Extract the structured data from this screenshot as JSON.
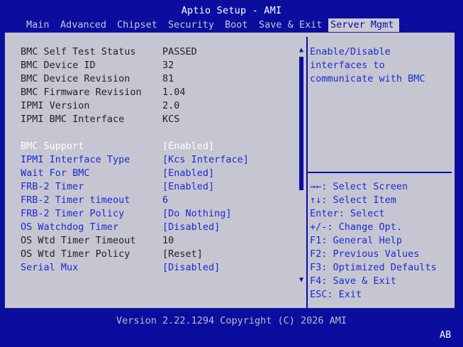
{
  "title": "Aptio Setup - AMI",
  "tabs": [
    "Main",
    "Advanced",
    "Chipset",
    "Security",
    "Boot",
    "Save & Exit",
    "Server Mgmt"
  ],
  "active_tab": "Server Mgmt",
  "info": [
    {
      "label": "BMC Self Test Status",
      "value": "PASSED"
    },
    {
      "label": "BMC Device ID",
      "value": "32"
    },
    {
      "label": "BMC Device Revision",
      "value": "81"
    },
    {
      "label": "BMC Firmware Revision",
      "value": "1.04"
    },
    {
      "label": "IPMI Version",
      "value": "2.0"
    },
    {
      "label": "IPMI BMC Interface",
      "value": "KCS"
    }
  ],
  "settings": [
    {
      "label": "BMC Support",
      "value": "[Enabled]"
    },
    {
      "label": "IPMI Interface Type",
      "value": "[Kcs Interface]"
    },
    {
      "label": "Wait For BMC",
      "value": "[Enabled]"
    },
    {
      "label": "FRB-2 Timer",
      "value": "[Enabled]"
    },
    {
      "label": "FRB-2 Timer timeout",
      "value": "6"
    },
    {
      "label": "FRB-2 Timer Policy",
      "value": "[Do Nothing]"
    },
    {
      "label": "OS Watchdog Timer",
      "value": "[Disabled]"
    },
    {
      "label": "OS Wtd Timer Timeout",
      "value": "10"
    },
    {
      "label": "OS Wtd Timer Policy",
      "value": "[Reset]"
    },
    {
      "label": "Serial Mux",
      "value": "[Disabled]"
    }
  ],
  "help_lines": [
    "Enable/Disable",
    "interfaces to",
    "communicate with BMC"
  ],
  "keys": [
    "→←: Select Screen",
    "↑↓: Select Item",
    "Enter: Select",
    "+/-: Change Opt.",
    "F1: General Help",
    "F2: Previous Values",
    "F3: Optimized Defaults",
    "F4: Save & Exit",
    "ESC: Exit"
  ],
  "footer": "Version 2.22.1294 Copyright (C) 2026 AMI",
  "corner": "AB",
  "colors": {
    "background": "#0b0d9e",
    "panel": "#c6c6d2",
    "link": "#1a2bd0",
    "selected": "#ffffff"
  }
}
